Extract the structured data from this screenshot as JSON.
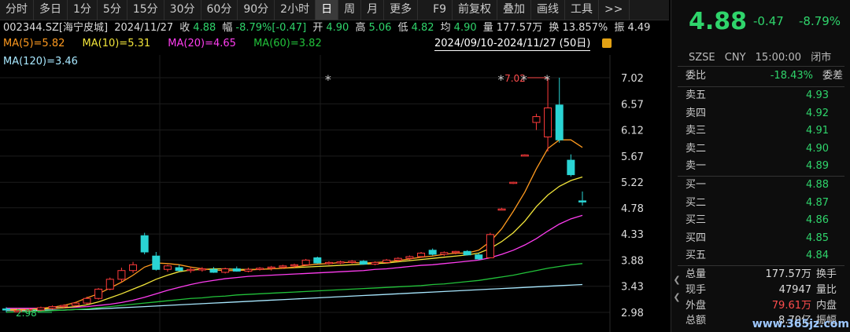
{
  "toolbar": {
    "items": [
      "分时",
      "多日",
      "1分",
      "5分",
      "15分",
      "30分",
      "60分",
      "90分",
      "2小时",
      "日",
      "周",
      "月",
      "更多",
      "F9",
      "前复权",
      "叠加",
      "画线",
      "工具",
      ">>"
    ],
    "active_index": 9
  },
  "info": {
    "code": "002344.SZ[海宁皮城]",
    "date": "2024/11/27",
    "close_label": "收",
    "close": "4.88",
    "amp_label": "幅",
    "amp": "-8.79%[-0.47]",
    "open_label": "开",
    "open": "4.90",
    "high_label": "高",
    "high": "5.06",
    "low_label": "低",
    "low": "4.82",
    "avg_label": "均",
    "avg": "4.90",
    "vol_label": "量",
    "vol": "177.57万",
    "turn_label": "换",
    "turn": "13.857%",
    "zhen_label": "振",
    "zhen": "4.49"
  },
  "ma": {
    "ma5": "MA(5)=5.82",
    "ma10": "MA(10)=5.31",
    "ma20": "MA(20)=4.65",
    "ma60": "MA(60)=3.82",
    "ma120": "MA(120)=3.46"
  },
  "range_label": "2024/09/10-2024/11/27 (50日)",
  "chart_data": {
    "type": "candlestick",
    "y_ticks": [
      "7.02",
      "6.57",
      "6.12",
      "5.67",
      "5.22",
      "4.78",
      "4.33",
      "3.88",
      "3.43",
      "2.98"
    ],
    "ylim": [
      2.98,
      7.02
    ],
    "high_marker": "7.02",
    "low_marker": "2.98",
    "colors": {
      "up": "#ff3b3b",
      "down": "#2ad4d4",
      "ma5": "#ff9a1f",
      "ma10": "#f2e53a",
      "ma20": "#ff3df0",
      "ma60": "#22c23a",
      "ma120": "#a8e8ff"
    },
    "candles": [
      {
        "o": 3.04,
        "h": 3.07,
        "l": 2.98,
        "c": 3.02
      },
      {
        "o": 3.0,
        "h": 3.05,
        "l": 2.98,
        "c": 3.01
      },
      {
        "o": 3.01,
        "h": 3.05,
        "l": 2.99,
        "c": 3.03
      },
      {
        "o": 3.02,
        "h": 3.08,
        "l": 3.0,
        "c": 3.06
      },
      {
        "o": 3.05,
        "h": 3.1,
        "l": 3.03,
        "c": 3.08
      },
      {
        "o": 3.08,
        "h": 3.12,
        "l": 3.05,
        "c": 3.1
      },
      {
        "o": 3.1,
        "h": 3.16,
        "l": 3.08,
        "c": 3.14
      },
      {
        "o": 3.14,
        "h": 3.25,
        "l": 3.12,
        "c": 3.22
      },
      {
        "o": 3.22,
        "h": 3.4,
        "l": 3.2,
        "c": 3.38
      },
      {
        "o": 3.38,
        "h": 3.58,
        "l": 3.36,
        "c": 3.55
      },
      {
        "o": 3.55,
        "h": 3.75,
        "l": 3.5,
        "c": 3.7
      },
      {
        "o": 3.7,
        "h": 3.85,
        "l": 3.66,
        "c": 3.8
      },
      {
        "o": 4.3,
        "h": 4.35,
        "l": 3.98,
        "c": 4.02
      },
      {
        "o": 3.95,
        "h": 4.02,
        "l": 3.7,
        "c": 3.72
      },
      {
        "o": 3.72,
        "h": 3.8,
        "l": 3.68,
        "c": 3.78
      },
      {
        "o": 3.75,
        "h": 3.8,
        "l": 3.68,
        "c": 3.7
      },
      {
        "o": 3.7,
        "h": 3.76,
        "l": 3.66,
        "c": 3.72
      },
      {
        "o": 3.72,
        "h": 3.76,
        "l": 3.68,
        "c": 3.73
      },
      {
        "o": 3.72,
        "h": 3.76,
        "l": 3.66,
        "c": 3.67
      },
      {
        "o": 3.67,
        "h": 3.75,
        "l": 3.65,
        "c": 3.73
      },
      {
        "o": 3.73,
        "h": 3.77,
        "l": 3.68,
        "c": 3.69
      },
      {
        "o": 3.69,
        "h": 3.75,
        "l": 3.67,
        "c": 3.72
      },
      {
        "o": 3.72,
        "h": 3.76,
        "l": 3.7,
        "c": 3.74
      },
      {
        "o": 3.74,
        "h": 3.78,
        "l": 3.7,
        "c": 3.76
      },
      {
        "o": 3.76,
        "h": 3.8,
        "l": 3.73,
        "c": 3.78
      },
      {
        "o": 3.78,
        "h": 3.82,
        "l": 3.75,
        "c": 3.8
      },
      {
        "o": 3.8,
        "h": 3.9,
        "l": 3.78,
        "c": 3.88
      },
      {
        "o": 3.92,
        "h": 3.94,
        "l": 3.82,
        "c": 3.83
      },
      {
        "o": 3.83,
        "h": 3.86,
        "l": 3.8,
        "c": 3.84
      },
      {
        "o": 3.84,
        "h": 3.87,
        "l": 3.81,
        "c": 3.85
      },
      {
        "o": 3.85,
        "h": 3.88,
        "l": 3.82,
        "c": 3.86
      },
      {
        "o": 3.86,
        "h": 3.88,
        "l": 3.8,
        "c": 3.81
      },
      {
        "o": 3.81,
        "h": 3.86,
        "l": 3.79,
        "c": 3.84
      },
      {
        "o": 3.84,
        "h": 3.9,
        "l": 3.82,
        "c": 3.88
      },
      {
        "o": 3.88,
        "h": 3.93,
        "l": 3.85,
        "c": 3.91
      },
      {
        "o": 3.91,
        "h": 3.96,
        "l": 3.88,
        "c": 3.94
      },
      {
        "o": 3.94,
        "h": 4.02,
        "l": 3.92,
        "c": 4.0
      },
      {
        "o": 4.05,
        "h": 4.08,
        "l": 3.96,
        "c": 3.98
      },
      {
        "o": 3.98,
        "h": 4.03,
        "l": 3.95,
        "c": 4.01
      },
      {
        "o": 4.01,
        "h": 4.04,
        "l": 3.98,
        "c": 4.03
      },
      {
        "o": 4.03,
        "h": 4.05,
        "l": 3.96,
        "c": 3.97
      },
      {
        "o": 3.97,
        "h": 4.0,
        "l": 3.88,
        "c": 3.9
      },
      {
        "o": 3.92,
        "h": 4.35,
        "l": 3.92,
        "c": 4.32
      },
      {
        "o": 4.74,
        "h": 4.78,
        "l": 4.74,
        "c": 4.76
      },
      {
        "o": 5.2,
        "h": 5.23,
        "l": 5.19,
        "c": 5.22
      },
      {
        "o": 5.67,
        "h": 5.7,
        "l": 5.67,
        "c": 5.69
      },
      {
        "o": 6.25,
        "h": 6.4,
        "l": 6.12,
        "c": 6.35
      },
      {
        "o": 6.0,
        "h": 7.02,
        "l": 5.75,
        "c": 6.5
      },
      {
        "o": 6.55,
        "h": 7.02,
        "l": 5.9,
        "c": 5.95
      },
      {
        "o": 5.6,
        "h": 5.7,
        "l": 5.32,
        "c": 5.35
      }
    ],
    "last_candle": {
      "o": 4.9,
      "h": 5.06,
      "l": 4.82,
      "c": 4.88
    },
    "ma5": [
      3.02,
      3.02,
      3.03,
      3.05,
      3.07,
      3.1,
      3.15,
      3.23,
      3.3,
      3.4,
      3.5,
      3.62,
      3.76,
      3.83,
      3.82,
      3.8,
      3.76,
      3.73,
      3.71,
      3.7,
      3.7,
      3.71,
      3.72,
      3.73,
      3.74,
      3.76,
      3.79,
      3.81,
      3.82,
      3.84,
      3.84,
      3.83,
      3.84,
      3.85,
      3.87,
      3.9,
      3.93,
      3.95,
      3.98,
      4.0,
      4.0,
      4.05,
      4.2,
      4.42,
      4.72,
      5.05,
      5.45,
      5.8,
      5.95,
      5.95,
      5.82
    ],
    "ma10": [
      3.03,
      3.03,
      3.03,
      3.04,
      3.05,
      3.06,
      3.08,
      3.11,
      3.16,
      3.23,
      3.3,
      3.38,
      3.46,
      3.55,
      3.62,
      3.68,
      3.71,
      3.72,
      3.73,
      3.73,
      3.72,
      3.72,
      3.72,
      3.73,
      3.74,
      3.75,
      3.76,
      3.77,
      3.78,
      3.79,
      3.8,
      3.81,
      3.82,
      3.83,
      3.85,
      3.87,
      3.89,
      3.91,
      3.93,
      3.95,
      3.97,
      4.0,
      4.08,
      4.2,
      4.35,
      4.55,
      4.8,
      5.0,
      5.15,
      5.25,
      5.31
    ],
    "ma20": [
      3.05,
      3.05,
      3.05,
      3.05,
      3.06,
      3.06,
      3.07,
      3.08,
      3.1,
      3.12,
      3.15,
      3.19,
      3.24,
      3.3,
      3.36,
      3.41,
      3.46,
      3.5,
      3.53,
      3.56,
      3.58,
      3.6,
      3.61,
      3.62,
      3.63,
      3.64,
      3.65,
      3.66,
      3.67,
      3.68,
      3.69,
      3.7,
      3.72,
      3.73,
      3.75,
      3.77,
      3.79,
      3.8,
      3.82,
      3.84,
      3.86,
      3.88,
      3.92,
      3.98,
      4.05,
      4.14,
      4.25,
      4.38,
      4.5,
      4.59,
      4.65
    ],
    "ma60": [
      2.98,
      2.99,
      2.99,
      3.0,
      3.01,
      3.02,
      3.03,
      3.04,
      3.06,
      3.08,
      3.1,
      3.12,
      3.14,
      3.16,
      3.18,
      3.2,
      3.22,
      3.23,
      3.25,
      3.26,
      3.28,
      3.29,
      3.3,
      3.31,
      3.32,
      3.33,
      3.34,
      3.35,
      3.36,
      3.37,
      3.38,
      3.39,
      3.4,
      3.41,
      3.42,
      3.43,
      3.44,
      3.46,
      3.47,
      3.49,
      3.51,
      3.53,
      3.56,
      3.59,
      3.62,
      3.66,
      3.7,
      3.74,
      3.77,
      3.8,
      3.82
    ],
    "ma120": [
      3.01,
      3.01,
      3.01,
      3.02,
      3.02,
      3.02,
      3.03,
      3.03,
      3.04,
      3.05,
      3.06,
      3.07,
      3.08,
      3.09,
      3.1,
      3.11,
      3.12,
      3.13,
      3.14,
      3.15,
      3.16,
      3.17,
      3.18,
      3.19,
      3.2,
      3.21,
      3.22,
      3.23,
      3.24,
      3.25,
      3.26,
      3.27,
      3.28,
      3.29,
      3.3,
      3.31,
      3.32,
      3.33,
      3.34,
      3.35,
      3.36,
      3.37,
      3.38,
      3.39,
      3.4,
      3.41,
      3.42,
      3.43,
      3.44,
      3.45,
      3.46
    ]
  },
  "quote": {
    "price": "4.88",
    "change": "-0.47",
    "pct": "-8.79%",
    "exchange": "SZSE",
    "currency": "CNY",
    "time": "15:00:00",
    "status": "闭市",
    "weibi_label": "委比",
    "weibi": "-18.43%",
    "weicha_label": "委差",
    "sell": [
      {
        "label": "卖五",
        "price": "4.93"
      },
      {
        "label": "卖四",
        "price": "4.92"
      },
      {
        "label": "卖三",
        "price": "4.91"
      },
      {
        "label": "卖二",
        "price": "4.90"
      },
      {
        "label": "卖一",
        "price": "4.89"
      }
    ],
    "buy": [
      {
        "label": "买一",
        "price": "4.88"
      },
      {
        "label": "买二",
        "price": "4.87"
      },
      {
        "label": "买三",
        "price": "4.86"
      },
      {
        "label": "买四",
        "price": "4.85"
      },
      {
        "label": "买五",
        "price": "4.84"
      }
    ],
    "summary": [
      {
        "label": "总量",
        "value": "177.57万",
        "label2": "换手",
        "color": "#ddd"
      },
      {
        "label": "现手",
        "value": "47947",
        "label2": "量比",
        "color": "#ddd"
      },
      {
        "label": "外盘",
        "value": "79.61万",
        "label2": "内盘",
        "color": "#ff4d4d"
      },
      {
        "label": "总额",
        "value": "8.70亿",
        "label2": "振幅",
        "color": "#ddd"
      }
    ],
    "watermark": "www.365jz.com"
  }
}
